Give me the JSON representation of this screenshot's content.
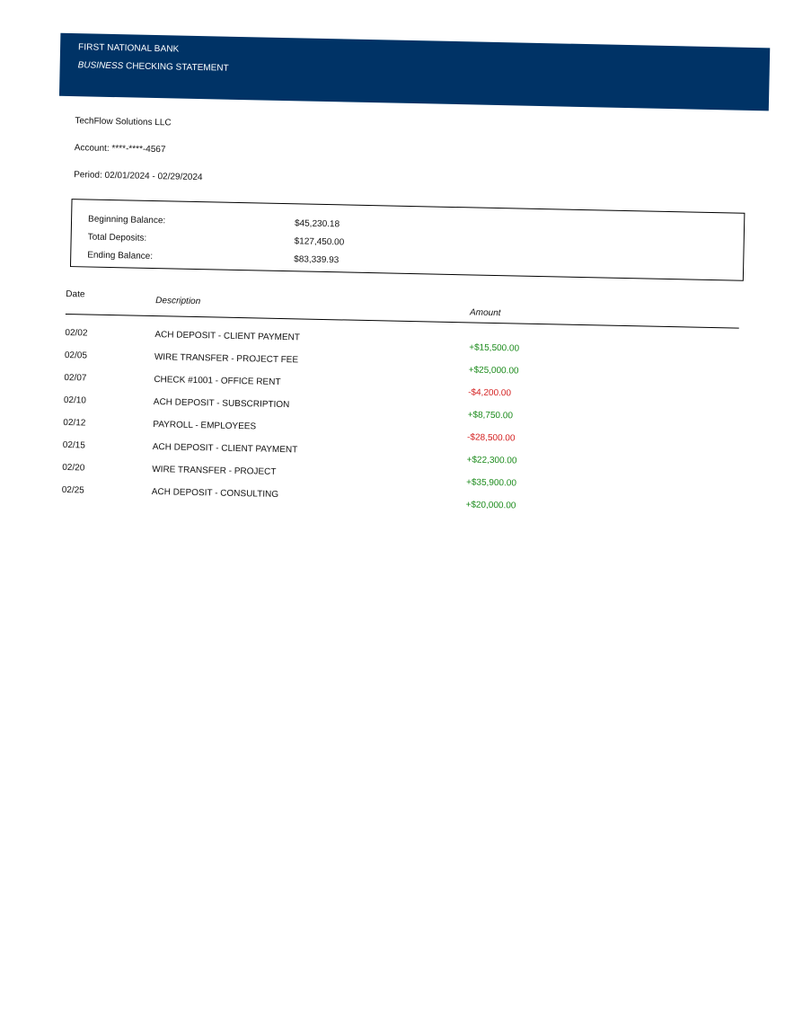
{
  "header": {
    "bank_name": "FIRST NATIONAL BANK",
    "subtitle_italic": "BUSINESS",
    "subtitle_rest": " CHECKING STATEMENT"
  },
  "account": {
    "holder": "TechFlow Solutions LLC",
    "account_line": "Account: ****-****-4567",
    "period_line": "Period: 02/01/2024 - 02/29/2024"
  },
  "summary": {
    "beginning_label": "Beginning Balance:",
    "beginning_value": "$45,230.18",
    "deposits_label": "Total Deposits:",
    "deposits_value": "$127,450.00",
    "ending_label": "Ending Balance:",
    "ending_value": "$83,339.93"
  },
  "table": {
    "headers": {
      "date": "Date",
      "description": "Description",
      "amount": "Amount"
    },
    "rows": [
      {
        "date": "02/02",
        "description": "ACH DEPOSIT - CLIENT PAYMENT",
        "amount": "+$15,500.00",
        "type": "credit"
      },
      {
        "date": "02/05",
        "description": "WIRE TRANSFER - PROJECT FEE",
        "amount": "+$25,000.00",
        "type": "credit"
      },
      {
        "date": "02/07",
        "description": "CHECK #1001 - OFFICE RENT",
        "amount": "-$4,200.00",
        "type": "debit"
      },
      {
        "date": "02/10",
        "description": "ACH DEPOSIT - SUBSCRIPTION",
        "amount": "+$8,750.00",
        "type": "credit"
      },
      {
        "date": "02/12",
        "description": "PAYROLL - EMPLOYEES",
        "amount": "-$28,500.00",
        "type": "debit"
      },
      {
        "date": "02/15",
        "description": "ACH DEPOSIT - CLIENT PAYMENT",
        "amount": "+$22,300.00",
        "type": "credit"
      },
      {
        "date": "02/20",
        "description": "WIRE TRANSFER - PROJECT",
        "amount": "+$35,900.00",
        "type": "credit"
      },
      {
        "date": "02/25",
        "description": "ACH DEPOSIT - CONSULTING",
        "amount": "+$20,000.00",
        "type": "credit"
      }
    ]
  },
  "colors": {
    "header_bg": "#003366",
    "credit": "#1a8a1a",
    "debit": "#d42020"
  }
}
